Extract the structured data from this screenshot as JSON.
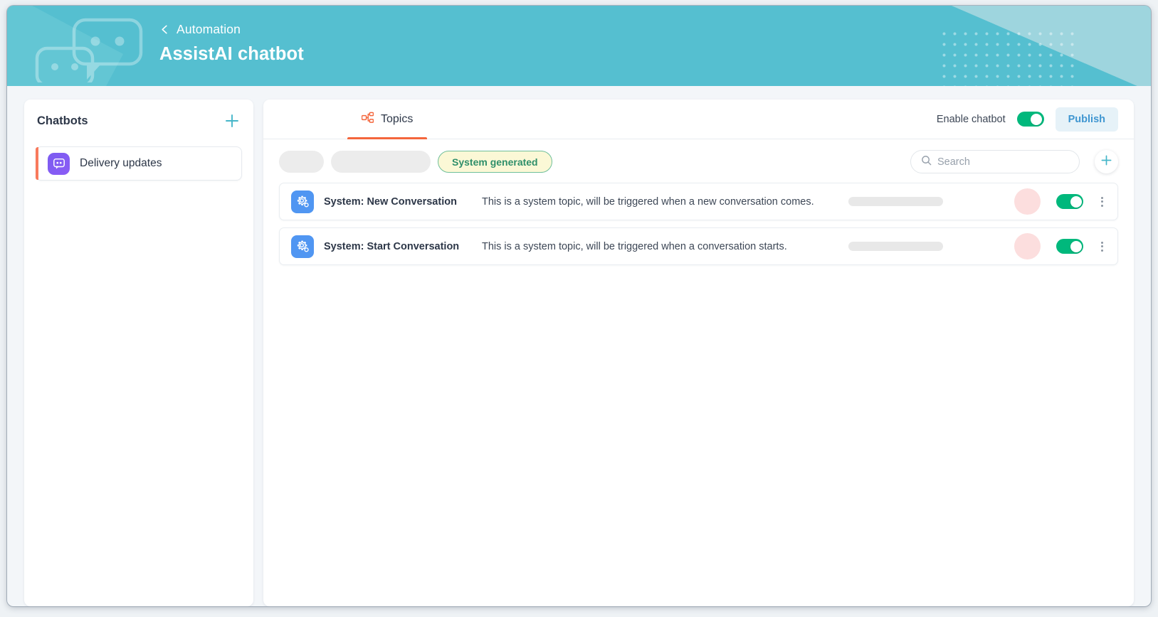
{
  "header": {
    "back_label": "Automation",
    "title": "AssistAI chatbot",
    "back_icon": "chevron-left-icon",
    "decor_bubbles_icon": "chat-bubbles-decoration-icon",
    "bg_color": "#55bfd0"
  },
  "sidebar": {
    "title": "Chatbots",
    "add_icon": "plus-icon",
    "items": [
      {
        "label": "Delivery updates",
        "icon": "chatbot-icon",
        "active": true,
        "accent": "#f87a5c"
      }
    ]
  },
  "main": {
    "tabs": [
      {
        "label": "Topics",
        "icon": "topics-hierarchy-icon",
        "active": true
      }
    ],
    "enable_chatbot_label": "Enable chatbot",
    "enable_chatbot_on": true,
    "publish_label": "Publish",
    "filters": {
      "skeleton_chips": 2,
      "system_generated_label": "System generated",
      "system_generated_selected": true
    },
    "search": {
      "placeholder": "Search",
      "value": "",
      "icon": "search-icon"
    },
    "add_topic_icon": "plus-icon",
    "topics": [
      {
        "icon": "system-gear-icon",
        "name": "System: New Conversation",
        "description": "This is a system topic, will be triggered when a new conversation comes.",
        "enabled": true,
        "menu_icon": "kebab-menu-icon"
      },
      {
        "icon": "system-gear-icon",
        "name": "System: Start Conversation",
        "description": "This is a system topic, will be triggered when a conversation starts.",
        "enabled": true,
        "menu_icon": "kebab-menu-icon"
      }
    ]
  },
  "colors": {
    "header_teal": "#55bfd0",
    "accent_orange": "#f4663c",
    "toggle_green": "#00b87c",
    "publish_blue": "#3f96d1",
    "chip_yellow": "#fbf8d6",
    "chip_green_border": "#6fbf9a",
    "avatar_pink": "#fcdede",
    "topic_icon_blue": "#5096f2",
    "chatbot_purple": "#8b5cf6"
  }
}
